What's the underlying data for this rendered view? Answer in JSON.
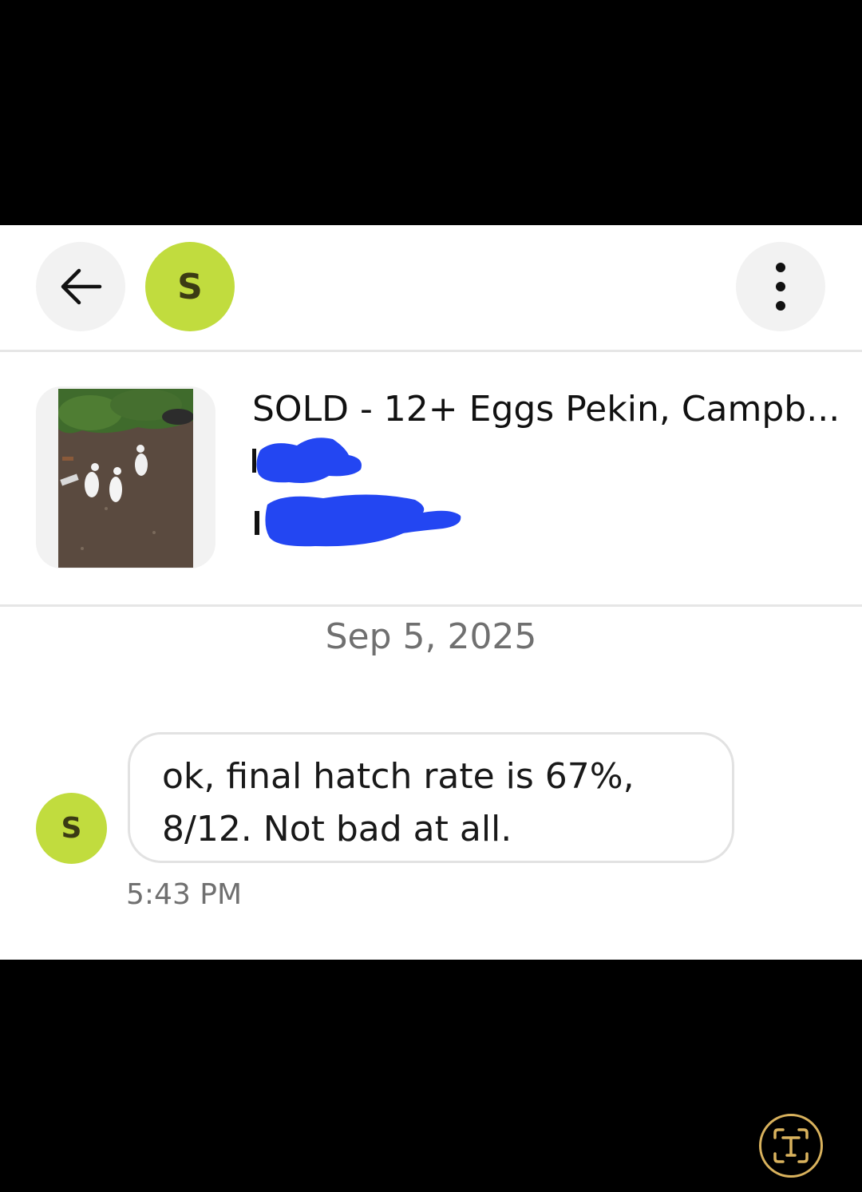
{
  "header": {
    "back_icon": "arrow-left-icon",
    "avatar_initial": "S",
    "more_icon": "more-vertical-icon"
  },
  "listing": {
    "title": "SOLD - 12+ Eggs Pekin, Campb..."
  },
  "conversation": {
    "date": "Sep 5, 2025",
    "messages": [
      {
        "avatar_initial": "S",
        "lines": [
          "ok, final hatch rate is 67%,",
          "8/12. Not bad at all."
        ],
        "time": "5:43 PM"
      }
    ]
  },
  "overlay": {
    "text_scan_icon": "live-text-icon"
  },
  "colors": {
    "avatar_bg": "#c1dc3e",
    "redaction": "#2346f2",
    "text_scan_ring": "#d9b25d"
  }
}
